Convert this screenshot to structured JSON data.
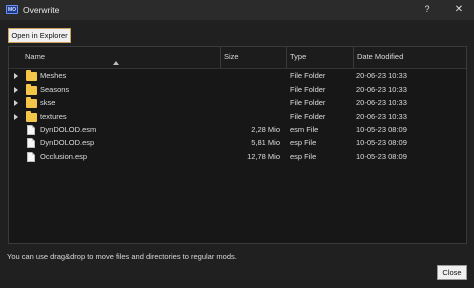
{
  "window": {
    "title": "Overwrite",
    "help_label": "?",
    "close_label": "✕",
    "app_icon_label": "MO"
  },
  "toolbar": {
    "open_explorer_label": "Open in Explorer"
  },
  "columns": {
    "name": "Name",
    "size": "Size",
    "type": "Type",
    "date": "Date Modified"
  },
  "rows": [
    {
      "name": "Meshes",
      "size": "",
      "type": "File Folder",
      "date": "20-06-23 10:33",
      "kind": "folder"
    },
    {
      "name": "Seasons",
      "size": "",
      "type": "File Folder",
      "date": "20-06-23 10:33",
      "kind": "folder"
    },
    {
      "name": "skse",
      "size": "",
      "type": "File Folder",
      "date": "20-06-23 10:33",
      "kind": "folder"
    },
    {
      "name": "textures",
      "size": "",
      "type": "File Folder",
      "date": "20-06-23 10:33",
      "kind": "folder"
    },
    {
      "name": "DynDOLOD.esm",
      "size": "2,28 Mio",
      "type": "esm File",
      "date": "10-05-23 08:09",
      "kind": "file"
    },
    {
      "name": "DynDOLOD.esp",
      "size": "5,81 Mio",
      "type": "esp File",
      "date": "10-05-23 08:09",
      "kind": "file"
    },
    {
      "name": "Occlusion.esp",
      "size": "12,78 Mio",
      "type": "esp File",
      "date": "10-05-23 08:09",
      "kind": "file"
    }
  ],
  "footer": {
    "hint": "You can use drag&drop to move files and directories to regular mods.",
    "close_label": "Close"
  },
  "colors": {
    "folder": "#f3c64a",
    "accent_border": "#c9a15a"
  }
}
